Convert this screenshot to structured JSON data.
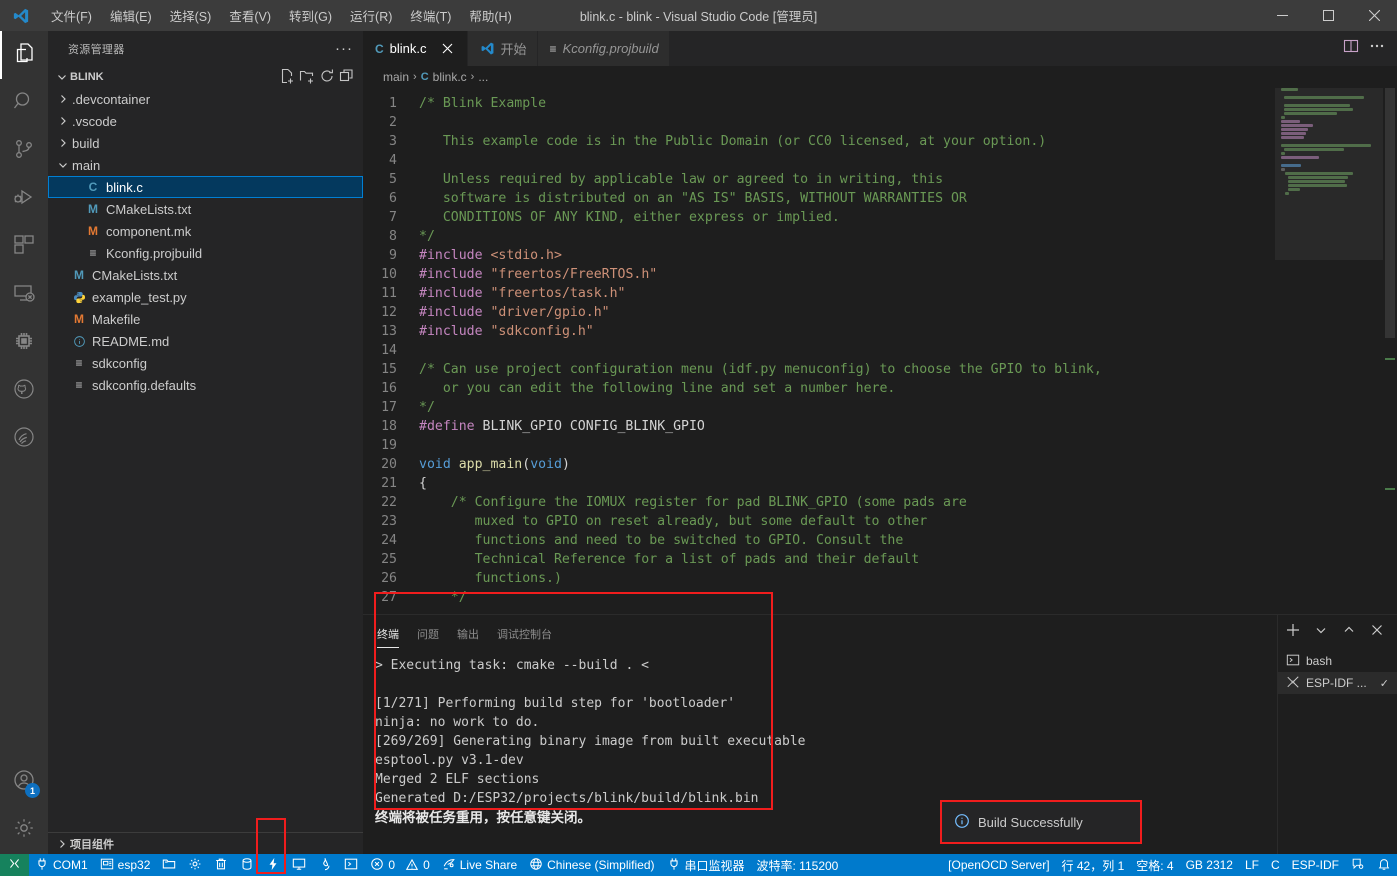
{
  "window": {
    "title": "blink.c - blink - Visual Studio Code [管理员]",
    "menu": [
      "文件(F)",
      "编辑(E)",
      "选择(S)",
      "查看(V)",
      "转到(G)",
      "运行(R)",
      "终端(T)",
      "帮助(H)"
    ],
    "controls": {
      "minimize": "minimize",
      "maximize": "maximize",
      "close": "close"
    }
  },
  "activitybar": {
    "items": [
      {
        "name": "explorer",
        "icon": "files-icon",
        "active": true
      },
      {
        "name": "search",
        "icon": "search-icon",
        "active": false
      },
      {
        "name": "source-control",
        "icon": "source-control-icon",
        "active": false
      },
      {
        "name": "run-and-debug",
        "icon": "run-debug-icon",
        "active": false
      },
      {
        "name": "extensions",
        "icon": "extensions-icon",
        "active": false
      },
      {
        "name": "remote-explorer",
        "icon": "remote-icon",
        "active": false
      },
      {
        "name": "esp-idf",
        "icon": "chip-icon",
        "active": false
      },
      {
        "name": "github",
        "icon": "github-icon",
        "active": false
      },
      {
        "name": "espressif",
        "icon": "espressif-icon",
        "active": false
      }
    ],
    "bottom": [
      {
        "name": "accounts",
        "icon": "account-icon",
        "badge": "1"
      },
      {
        "name": "manage-settings",
        "icon": "gear-icon",
        "badge": ""
      }
    ]
  },
  "sidebar": {
    "title": "资源管理器",
    "more_label": "···",
    "project": {
      "name": "BLINK",
      "actions": [
        "new-file-icon",
        "new-folder-icon",
        "refresh-icon",
        "collapse-all-icon"
      ]
    },
    "tree": [
      {
        "label": ".devcontainer",
        "type": "folder",
        "indent": 1,
        "expanded": false,
        "icon": "chevron-right-icon"
      },
      {
        "label": ".vscode",
        "type": "folder",
        "indent": 1,
        "expanded": false,
        "icon": "chevron-right-icon"
      },
      {
        "label": "build",
        "type": "folder",
        "indent": 1,
        "expanded": false,
        "icon": "chevron-right-icon"
      },
      {
        "label": "main",
        "type": "folder",
        "indent": 1,
        "expanded": true,
        "icon": "chevron-down-icon"
      },
      {
        "label": "blink.c",
        "type": "file",
        "indent": 2,
        "badge": "C",
        "badgeclass": "ic-c",
        "selected": true
      },
      {
        "label": "CMakeLists.txt",
        "type": "file",
        "indent": 2,
        "badge": "M",
        "badgeclass": "ic-m"
      },
      {
        "label": "component.mk",
        "type": "file",
        "indent": 2,
        "badge": "M",
        "badgeclass": "ic-mk"
      },
      {
        "label": "Kconfig.projbuild",
        "type": "file",
        "indent": 2,
        "badge": "≡",
        "badgeclass": "ic-txt"
      },
      {
        "label": "CMakeLists.txt",
        "type": "file",
        "indent": 1,
        "badge": "M",
        "badgeclass": "ic-m"
      },
      {
        "label": "example_test.py",
        "type": "file",
        "indent": 1,
        "badge": "py",
        "badgeclass": "ic-py"
      },
      {
        "label": "Makefile",
        "type": "file",
        "indent": 1,
        "badge": "M",
        "badgeclass": "ic-mk"
      },
      {
        "label": "README.md",
        "type": "file",
        "indent": 1,
        "badge": "i",
        "badgeclass": "ic-info"
      },
      {
        "label": "sdkconfig",
        "type": "file",
        "indent": 1,
        "badge": "≡",
        "badgeclass": "ic-txt"
      },
      {
        "label": "sdkconfig.defaults",
        "type": "file",
        "indent": 1,
        "badge": "≡",
        "badgeclass": "ic-txt"
      }
    ],
    "bottom_section": "项目组件"
  },
  "editor": {
    "tabs": [
      {
        "label": "blink.c",
        "icon": "c-file-icon",
        "active": true,
        "dirty": false,
        "closable": true,
        "italic": false
      },
      {
        "label": "开始",
        "icon": "vscode-logo-icon",
        "active": false,
        "closable": false,
        "italic": false
      },
      {
        "label": "Kconfig.projbuild",
        "icon": "text-file-icon",
        "active": false,
        "closable": false,
        "italic": true
      }
    ],
    "tab_actions": [
      "split-editor-icon",
      "more-actions-icon"
    ],
    "breadcrumb": [
      "main",
      "blink.c",
      "..."
    ],
    "breadcrumb_file_icon": "c-file-icon",
    "first_line": 1,
    "lines": [
      {
        "n": 1,
        "tokens": [
          {
            "t": "/* Blink Example",
            "c": "cmt"
          }
        ]
      },
      {
        "n": 2,
        "tokens": []
      },
      {
        "n": 3,
        "tokens": [
          {
            "t": "   This example code is in the Public Domain (or CC0 licensed, at your option.)",
            "c": "cmt"
          }
        ]
      },
      {
        "n": 4,
        "tokens": []
      },
      {
        "n": 5,
        "tokens": [
          {
            "t": "   Unless required by applicable law or agreed to in writing, this",
            "c": "cmt"
          }
        ]
      },
      {
        "n": 6,
        "tokens": [
          {
            "t": "   software is distributed on an \"AS IS\" BASIS, WITHOUT WARRANTIES OR",
            "c": "cmt"
          }
        ]
      },
      {
        "n": 7,
        "tokens": [
          {
            "t": "   CONDITIONS OF ANY KIND, either express or implied.",
            "c": "cmt"
          }
        ]
      },
      {
        "n": 8,
        "tokens": [
          {
            "t": "*/",
            "c": "cmt"
          }
        ]
      },
      {
        "n": 9,
        "tokens": [
          {
            "t": "#include",
            "c": "pre"
          },
          {
            "t": " ",
            "c": ""
          },
          {
            "t": "<stdio.h>",
            "c": "str"
          }
        ]
      },
      {
        "n": 10,
        "tokens": [
          {
            "t": "#include",
            "c": "pre"
          },
          {
            "t": " ",
            "c": ""
          },
          {
            "t": "\"freertos/FreeRTOS.h\"",
            "c": "str"
          }
        ]
      },
      {
        "n": 11,
        "tokens": [
          {
            "t": "#include",
            "c": "pre"
          },
          {
            "t": " ",
            "c": ""
          },
          {
            "t": "\"freertos/task.h\"",
            "c": "str"
          }
        ]
      },
      {
        "n": 12,
        "tokens": [
          {
            "t": "#include",
            "c": "pre"
          },
          {
            "t": " ",
            "c": ""
          },
          {
            "t": "\"driver/gpio.h\"",
            "c": "str"
          }
        ]
      },
      {
        "n": 13,
        "tokens": [
          {
            "t": "#include",
            "c": "pre"
          },
          {
            "t": " ",
            "c": ""
          },
          {
            "t": "\"sdkconfig.h\"",
            "c": "str"
          }
        ]
      },
      {
        "n": 14,
        "tokens": []
      },
      {
        "n": 15,
        "tokens": [
          {
            "t": "/* Can use project configuration menu (idf.py menuconfig) to choose the GPIO to blink,",
            "c": "cmt"
          }
        ]
      },
      {
        "n": 16,
        "tokens": [
          {
            "t": "   or you can edit the following line and set a number here.",
            "c": "cmt"
          }
        ]
      },
      {
        "n": 17,
        "tokens": [
          {
            "t": "*/",
            "c": "cmt"
          }
        ]
      },
      {
        "n": 18,
        "tokens": [
          {
            "t": "#define",
            "c": "pre"
          },
          {
            "t": " BLINK_GPIO CONFIG_BLINK_GPIO",
            "c": ""
          }
        ]
      },
      {
        "n": 19,
        "tokens": []
      },
      {
        "n": 20,
        "tokens": [
          {
            "t": "void",
            "c": "kw"
          },
          {
            "t": " ",
            "c": ""
          },
          {
            "t": "app_main",
            "c": "fn"
          },
          {
            "t": "(",
            "c": ""
          },
          {
            "t": "void",
            "c": "kw"
          },
          {
            "t": ")",
            "c": ""
          }
        ]
      },
      {
        "n": 21,
        "tokens": [
          {
            "t": "{",
            "c": ""
          }
        ]
      },
      {
        "n": 22,
        "tokens": [
          {
            "t": "    /* Configure the IOMUX register for pad BLINK_GPIO (some pads are",
            "c": "cmt"
          }
        ]
      },
      {
        "n": 23,
        "tokens": [
          {
            "t": "       muxed to GPIO on reset already, but some default to other",
            "c": "cmt"
          }
        ]
      },
      {
        "n": 24,
        "tokens": [
          {
            "t": "       functions and need to be switched to GPIO. Consult the",
            "c": "cmt"
          }
        ]
      },
      {
        "n": 25,
        "tokens": [
          {
            "t": "       Technical Reference for a list of pads and their default",
            "c": "cmt"
          }
        ]
      },
      {
        "n": 26,
        "tokens": [
          {
            "t": "       functions.)",
            "c": "cmt"
          }
        ]
      },
      {
        "n": 27,
        "tokens": [
          {
            "t": "    */",
            "c": "cmt"
          }
        ]
      }
    ]
  },
  "panel": {
    "tabs": [
      {
        "label": "终端",
        "active": true
      },
      {
        "label": "问题",
        "active": false
      },
      {
        "label": "输出",
        "active": false
      },
      {
        "label": "调试控制台",
        "active": false
      }
    ],
    "actions": [
      "new-terminal-icon",
      "chevron-down-icon",
      "maximize-panel-icon",
      "close-panel-icon"
    ],
    "terminal_output": "> Executing task: cmake --build . <\n\n[1/271] Performing build step for 'bootloader'\nninja: no work to do.\n[269/269] Generating binary image from built executable\nesptool.py v3.1-dev\nMerged 2 ELF sections\nGenerated D:/ESP32/projects/blink/build/blink.bin\n",
    "terminal_footer": "终端将被任务重用，按任意键关闭。",
    "terminal_list": [
      {
        "label": "bash",
        "icon": "terminal-icon",
        "active": false,
        "check": ""
      },
      {
        "label": "ESP-IDF ...",
        "icon": "tools-icon",
        "active": true,
        "check": "✓"
      }
    ]
  },
  "notification": {
    "icon": "info-icon",
    "message": "Build Successfully"
  },
  "statusbar": {
    "remote": {
      "icon": "remote-icon",
      "label": ""
    },
    "left": [
      {
        "icon": "plug-icon",
        "label": "COM1",
        "name": "serial-port"
      },
      {
        "icon": "board-icon",
        "label": "esp32",
        "name": "device-target"
      },
      {
        "icon": "folder-icon",
        "label": "",
        "name": "sdk-configuration-editor"
      },
      {
        "icon": "gear-icon",
        "label": "",
        "name": "menuconfig"
      },
      {
        "icon": "trash-icon",
        "label": "",
        "name": "full-clean"
      },
      {
        "icon": "database-icon",
        "label": "",
        "name": "build-project"
      },
      {
        "icon": "flash-icon",
        "label": "",
        "name": "flash-device"
      },
      {
        "icon": "monitor-icon",
        "label": "",
        "name": "monitor-device"
      },
      {
        "icon": "flame-icon",
        "label": "",
        "name": "build-flash-monitor"
      },
      {
        "icon": "terminal-icon",
        "label": "",
        "name": "open-esp-idf-terminal"
      },
      {
        "icon": "error-icon",
        "label": "0",
        "name": "error-count"
      },
      {
        "icon": "warning-icon",
        "label": "0",
        "name": "warning-count"
      },
      {
        "icon": "live-share-icon",
        "label": "Live Share",
        "name": "live-share"
      },
      {
        "icon": "globe-icon",
        "label": "Chinese (Simplified)",
        "name": "language-pack"
      },
      {
        "icon": "plug-icon",
        "label": "串口监视器",
        "name": "serial-monitor"
      },
      {
        "icon": "",
        "label": "波特率: 115200",
        "name": "baud-rate"
      }
    ],
    "right": [
      {
        "icon": "",
        "label": "[OpenOCD Server]",
        "name": "openocd-server"
      },
      {
        "icon": "",
        "label": "行 42，列 1",
        "name": "cursor-position"
      },
      {
        "icon": "",
        "label": "空格: 4",
        "name": "indentation"
      },
      {
        "icon": "",
        "label": "GB 2312",
        "name": "encoding"
      },
      {
        "icon": "",
        "label": "LF",
        "name": "eol-sequence"
      },
      {
        "icon": "",
        "label": "C",
        "name": "language-mode"
      },
      {
        "icon": "",
        "label": "ESP-IDF",
        "name": "esp-idf-status"
      },
      {
        "icon": "feedback-icon",
        "label": "",
        "name": "tweet-feedback"
      },
      {
        "icon": "bell-icon",
        "label": "",
        "name": "notifications"
      }
    ]
  },
  "colors": {
    "accent": "#007acc",
    "remote": "#16825d",
    "selection": "#04395e",
    "annotation_red": "#f01d1d",
    "comment": "#6a9955",
    "preprocessor": "#c586c0",
    "string": "#ce9178",
    "keyword": "#569cd6"
  }
}
